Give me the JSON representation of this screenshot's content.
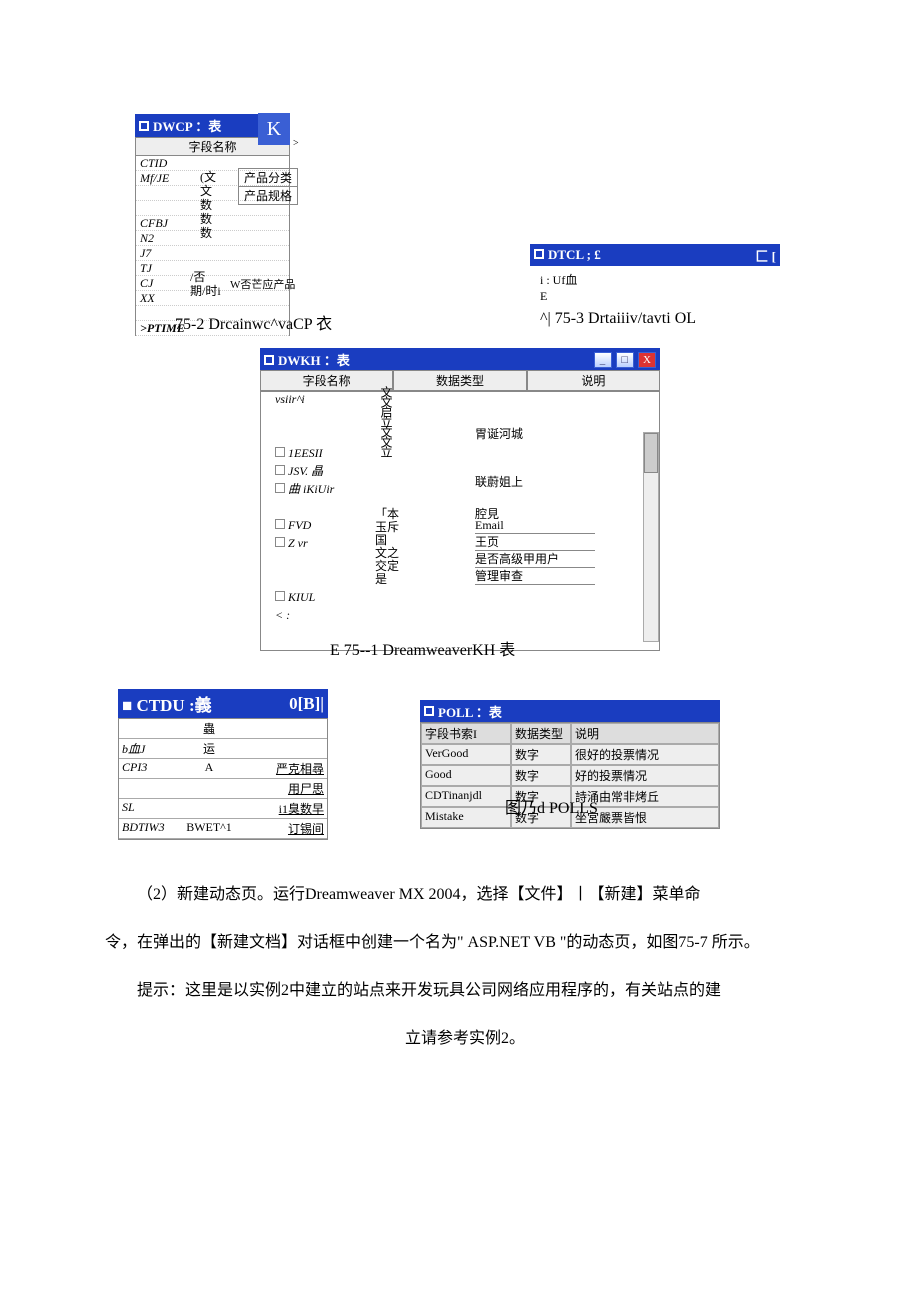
{
  "dwcp": {
    "title": "DWCP ：表",
    "field_header": "字段名称",
    "rows": [
      "CTID",
      "Mf/JE",
      "",
      "",
      "CFBJ",
      "N2",
      "J7",
      "TJ",
      "CJ",
      "XX"
    ],
    "col2_top": [
      "(文",
      "文",
      "数",
      "数",
      "数"
    ],
    "ptime_label": ">PTIME",
    "bot1": "/否",
    "bot2": "期/时i",
    "col3_label1": "产品分类",
    "col3_label2": "产品规格",
    "wtext": "W否芒应产品"
  },
  "blue_k": "K",
  "caret": ">",
  "cap1": "75-2 Drcainwc^vaCP 衣",
  "dtcl": {
    "title": "DTCL ; £",
    "close": "匚 [",
    "line1": "i : Uf血",
    "line2": "E"
  },
  "cap2": "^| 75-3 Drtaiiiv/tavti OL",
  "dwkh": {
    "title": "DWKH ：表",
    "hdr1": "字段名称",
    "hdr2": "数据类型",
    "hdr3": "说明",
    "left": [
      "vsiir^i",
      "",
      "",
      "1EESII",
      "JSV. 晶",
      "曲 iKiUir",
      "",
      "FVD",
      "Z vr",
      "",
      "",
      "KIUL",
      "< :"
    ],
    "mid": "文文启立文文立",
    "mid2": [
      "「本玉斥国",
      "文之交定是"
    ],
    "right1": [
      "",
      "",
      "胃诞河城",
      "",
      "",
      "联蔚姐上",
      "",
      "腔見"
    ],
    "right2": [
      "Email",
      "王页",
      "是否高级甲用户",
      "管理审查"
    ]
  },
  "cap3": "E 75--1 DreamweaverKH 表",
  "ctdu": {
    "title_left": "■ CTDU :義",
    "title_right": "0[B]|",
    "hdr": "蟲",
    "rows": [
      {
        "c1": "b血J",
        "c2": "运",
        "c3": ""
      },
      {
        "c1": "CPI3",
        "c2": "A",
        "c3": "严克相尋"
      },
      {
        "c1": "",
        "c2": "",
        "c3": "用尸思"
      },
      {
        "c1": "SL",
        "c2": "",
        "c3": "i1臭数早"
      },
      {
        "c1": "BDTIW3",
        "c2": "BWET^1",
        "c3": "订锡间"
      }
    ]
  },
  "poll": {
    "title": "POLL ：表",
    "hdr": [
      "字段书索I",
      "数据类型",
      "说明"
    ],
    "rows": [
      [
        "VerGood",
        "数字",
        "很好的投票情况"
      ],
      [
        "Good",
        "数字",
        "好的投票情况"
      ],
      [
        "CDTinanjdl",
        "数字",
        "詩涌由常非烤丘"
      ],
      [
        "Mistake",
        "数字",
        "坐宮嚴票皆恨"
      ]
    ]
  },
  "cap4": "图乃d POLLS",
  "paragraphs": {
    "p1": "（2）新建动态页。运行Dreamweaver MX 2004，选择【文件】丨【新建】菜单命",
    "p2": "令，在弹出的【新建文档】对话框中创建一个名为\" ASP.NET VB \"的动态页，如图75-7 所示。",
    "p3": "提示：这里是以实例2中建立的站点来开发玩具公司网络应用程序的，有关站点的建",
    "p4": "立请参考实例2。"
  }
}
